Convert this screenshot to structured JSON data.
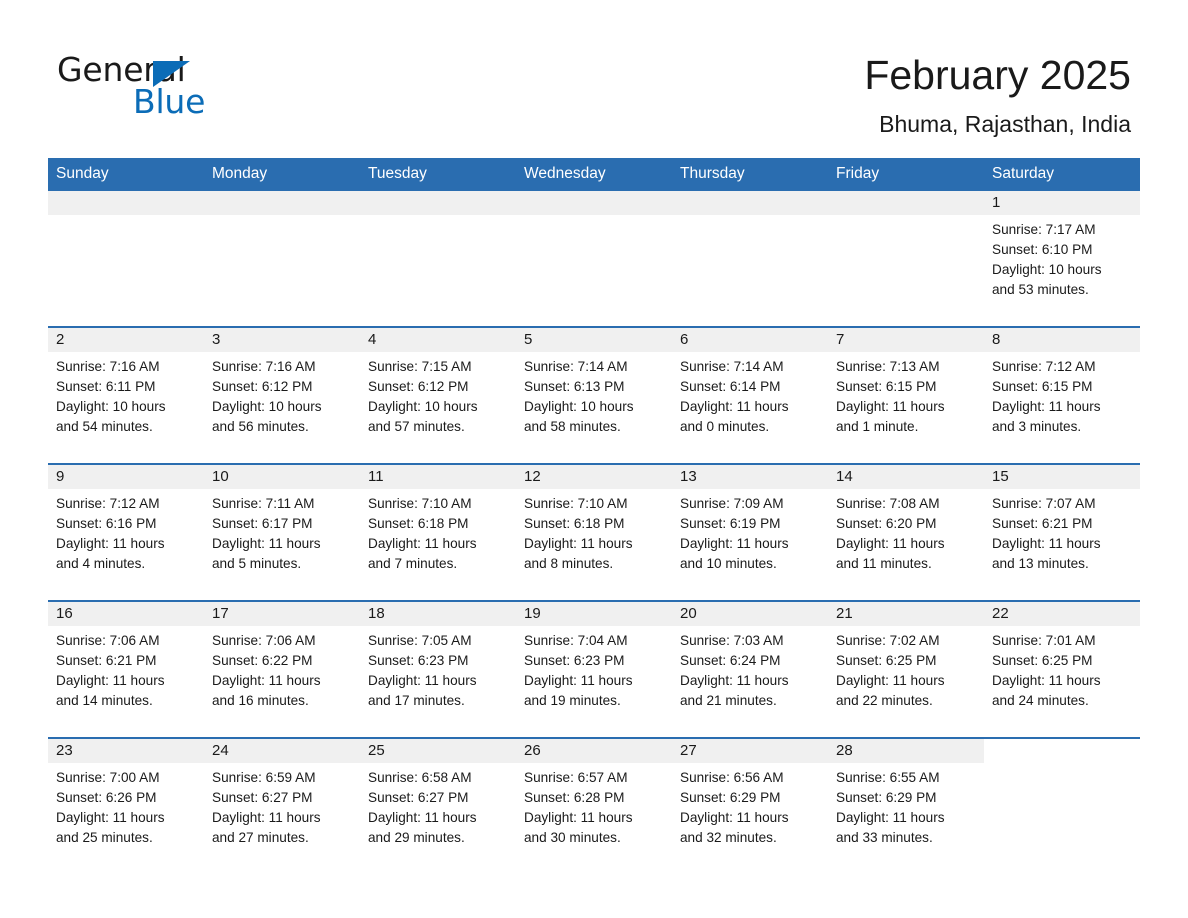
{
  "brand": {
    "name_part1": "General",
    "name_part2": "Blue",
    "triangle_icon": "triangle-logo-icon",
    "accent_color": "#0b6cb7"
  },
  "header": {
    "month_title": "February 2025",
    "location": "Bhuma, Rajasthan, India"
  },
  "theme": {
    "header_blue": "#2a6db0",
    "row_divider_blue": "#2a6db0",
    "daynum_band_gray": "#f0f0f0",
    "text_color": "#1a1a1a"
  },
  "weekday_headers": [
    "Sunday",
    "Monday",
    "Tuesday",
    "Wednesday",
    "Thursday",
    "Friday",
    "Saturday"
  ],
  "weeks": [
    [
      {
        "day": "",
        "sunrise": "",
        "sunset": "",
        "daylight_line1": "",
        "daylight_line2": ""
      },
      {
        "day": "",
        "sunrise": "",
        "sunset": "",
        "daylight_line1": "",
        "daylight_line2": ""
      },
      {
        "day": "",
        "sunrise": "",
        "sunset": "",
        "daylight_line1": "",
        "daylight_line2": ""
      },
      {
        "day": "",
        "sunrise": "",
        "sunset": "",
        "daylight_line1": "",
        "daylight_line2": ""
      },
      {
        "day": "",
        "sunrise": "",
        "sunset": "",
        "daylight_line1": "",
        "daylight_line2": ""
      },
      {
        "day": "",
        "sunrise": "",
        "sunset": "",
        "daylight_line1": "",
        "daylight_line2": ""
      },
      {
        "day": "1",
        "sunrise": "Sunrise: 7:17 AM",
        "sunset": "Sunset: 6:10 PM",
        "daylight_line1": "Daylight: 10 hours",
        "daylight_line2": "and 53 minutes."
      }
    ],
    [
      {
        "day": "2",
        "sunrise": "Sunrise: 7:16 AM",
        "sunset": "Sunset: 6:11 PM",
        "daylight_line1": "Daylight: 10 hours",
        "daylight_line2": "and 54 minutes."
      },
      {
        "day": "3",
        "sunrise": "Sunrise: 7:16 AM",
        "sunset": "Sunset: 6:12 PM",
        "daylight_line1": "Daylight: 10 hours",
        "daylight_line2": "and 56 minutes."
      },
      {
        "day": "4",
        "sunrise": "Sunrise: 7:15 AM",
        "sunset": "Sunset: 6:12 PM",
        "daylight_line1": "Daylight: 10 hours",
        "daylight_line2": "and 57 minutes."
      },
      {
        "day": "5",
        "sunrise": "Sunrise: 7:14 AM",
        "sunset": "Sunset: 6:13 PM",
        "daylight_line1": "Daylight: 10 hours",
        "daylight_line2": "and 58 minutes."
      },
      {
        "day": "6",
        "sunrise": "Sunrise: 7:14 AM",
        "sunset": "Sunset: 6:14 PM",
        "daylight_line1": "Daylight: 11 hours",
        "daylight_line2": "and 0 minutes."
      },
      {
        "day": "7",
        "sunrise": "Sunrise: 7:13 AM",
        "sunset": "Sunset: 6:15 PM",
        "daylight_line1": "Daylight: 11 hours",
        "daylight_line2": "and 1 minute."
      },
      {
        "day": "8",
        "sunrise": "Sunrise: 7:12 AM",
        "sunset": "Sunset: 6:15 PM",
        "daylight_line1": "Daylight: 11 hours",
        "daylight_line2": "and 3 minutes."
      }
    ],
    [
      {
        "day": "9",
        "sunrise": "Sunrise: 7:12 AM",
        "sunset": "Sunset: 6:16 PM",
        "daylight_line1": "Daylight: 11 hours",
        "daylight_line2": "and 4 minutes."
      },
      {
        "day": "10",
        "sunrise": "Sunrise: 7:11 AM",
        "sunset": "Sunset: 6:17 PM",
        "daylight_line1": "Daylight: 11 hours",
        "daylight_line2": "and 5 minutes."
      },
      {
        "day": "11",
        "sunrise": "Sunrise: 7:10 AM",
        "sunset": "Sunset: 6:18 PM",
        "daylight_line1": "Daylight: 11 hours",
        "daylight_line2": "and 7 minutes."
      },
      {
        "day": "12",
        "sunrise": "Sunrise: 7:10 AM",
        "sunset": "Sunset: 6:18 PM",
        "daylight_line1": "Daylight: 11 hours",
        "daylight_line2": "and 8 minutes."
      },
      {
        "day": "13",
        "sunrise": "Sunrise: 7:09 AM",
        "sunset": "Sunset: 6:19 PM",
        "daylight_line1": "Daylight: 11 hours",
        "daylight_line2": "and 10 minutes."
      },
      {
        "day": "14",
        "sunrise": "Sunrise: 7:08 AM",
        "sunset": "Sunset: 6:20 PM",
        "daylight_line1": "Daylight: 11 hours",
        "daylight_line2": "and 11 minutes."
      },
      {
        "day": "15",
        "sunrise": "Sunrise: 7:07 AM",
        "sunset": "Sunset: 6:21 PM",
        "daylight_line1": "Daylight: 11 hours",
        "daylight_line2": "and 13 minutes."
      }
    ],
    [
      {
        "day": "16",
        "sunrise": "Sunrise: 7:06 AM",
        "sunset": "Sunset: 6:21 PM",
        "daylight_line1": "Daylight: 11 hours",
        "daylight_line2": "and 14 minutes."
      },
      {
        "day": "17",
        "sunrise": "Sunrise: 7:06 AM",
        "sunset": "Sunset: 6:22 PM",
        "daylight_line1": "Daylight: 11 hours",
        "daylight_line2": "and 16 minutes."
      },
      {
        "day": "18",
        "sunrise": "Sunrise: 7:05 AM",
        "sunset": "Sunset: 6:23 PM",
        "daylight_line1": "Daylight: 11 hours",
        "daylight_line2": "and 17 minutes."
      },
      {
        "day": "19",
        "sunrise": "Sunrise: 7:04 AM",
        "sunset": "Sunset: 6:23 PM",
        "daylight_line1": "Daylight: 11 hours",
        "daylight_line2": "and 19 minutes."
      },
      {
        "day": "20",
        "sunrise": "Sunrise: 7:03 AM",
        "sunset": "Sunset: 6:24 PM",
        "daylight_line1": "Daylight: 11 hours",
        "daylight_line2": "and 21 minutes."
      },
      {
        "day": "21",
        "sunrise": "Sunrise: 7:02 AM",
        "sunset": "Sunset: 6:25 PM",
        "daylight_line1": "Daylight: 11 hours",
        "daylight_line2": "and 22 minutes."
      },
      {
        "day": "22",
        "sunrise": "Sunrise: 7:01 AM",
        "sunset": "Sunset: 6:25 PM",
        "daylight_line1": "Daylight: 11 hours",
        "daylight_line2": "and 24 minutes."
      }
    ],
    [
      {
        "day": "23",
        "sunrise": "Sunrise: 7:00 AM",
        "sunset": "Sunset: 6:26 PM",
        "daylight_line1": "Daylight: 11 hours",
        "daylight_line2": "and 25 minutes."
      },
      {
        "day": "24",
        "sunrise": "Sunrise: 6:59 AM",
        "sunset": "Sunset: 6:27 PM",
        "daylight_line1": "Daylight: 11 hours",
        "daylight_line2": "and 27 minutes."
      },
      {
        "day": "25",
        "sunrise": "Sunrise: 6:58 AM",
        "sunset": "Sunset: 6:27 PM",
        "daylight_line1": "Daylight: 11 hours",
        "daylight_line2": "and 29 minutes."
      },
      {
        "day": "26",
        "sunrise": "Sunrise: 6:57 AM",
        "sunset": "Sunset: 6:28 PM",
        "daylight_line1": "Daylight: 11 hours",
        "daylight_line2": "and 30 minutes."
      },
      {
        "day": "27",
        "sunrise": "Sunrise: 6:56 AM",
        "sunset": "Sunset: 6:29 PM",
        "daylight_line1": "Daylight: 11 hours",
        "daylight_line2": "and 32 minutes."
      },
      {
        "day": "28",
        "sunrise": "Sunrise: 6:55 AM",
        "sunset": "Sunset: 6:29 PM",
        "daylight_line1": "Daylight: 11 hours",
        "daylight_line2": "and 33 minutes."
      },
      {
        "day": "",
        "sunrise": "",
        "sunset": "",
        "daylight_line1": "",
        "daylight_line2": ""
      }
    ]
  ]
}
